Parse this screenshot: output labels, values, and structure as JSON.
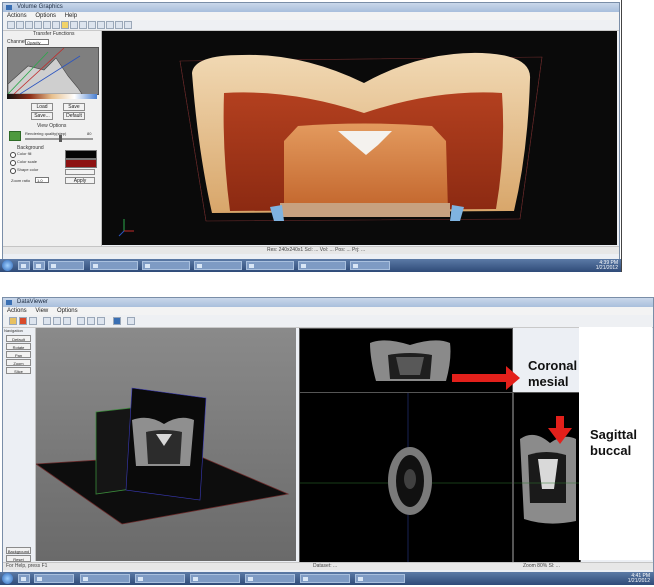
{
  "top_window": {
    "title": "Volume Graphics",
    "menu": [
      "Actions",
      "Options",
      "Help"
    ],
    "left_panel": {
      "section_title": "Transfer Functions",
      "channel_label": "Channel",
      "channel_value": "Opacity",
      "buttons": [
        "Load",
        "Save",
        "Save...",
        "Default"
      ],
      "view_section": "View Options",
      "quality_label": "Rendering quality(step)",
      "quality_value": "80",
      "background_label": "Background",
      "bg_options": [
        "Color fill",
        "Color scale",
        "Shape color"
      ],
      "zoom_label": "Zoom ratio",
      "zoom_value": "1.0",
      "apply_button": "Apply"
    },
    "status_text": "Res: 240x240x1 Scl: ... Vol: ... Pos: ... Prj: ...",
    "colors": {
      "bg_dark": "#0a0a0a",
      "tooth_outer": "#e9c79a",
      "tooth_inner": "#a8361c"
    }
  },
  "top_taskbar": {
    "tasks": [
      "",
      ""
    ],
    "tray_time": "4:39 PM",
    "tray_date": "1/21/2012"
  },
  "bottom_window": {
    "title": "DataViewer",
    "menu": [
      "Actions",
      "View",
      "Options"
    ],
    "left_buttons_title": "Navigation",
    "left_buttons": [
      "Default",
      "Rotate",
      "Pan",
      "Zoom",
      "Slice"
    ],
    "bottom_left_buttons": [
      "Background",
      "Reset"
    ],
    "status_left": "For Help, press F1",
    "status_mid": "Dataset: ...",
    "status_right": "Zoom 80% Sl: ..."
  },
  "bottom_taskbar": {
    "tray_time": "4:41 PM",
    "tray_date": "1/21/2012"
  },
  "annotations": {
    "coronal_line1": "Coronal",
    "coronal_line2": "mesial",
    "sagittal_line1": "Sagittal",
    "sagittal_line2": "buccal",
    "arrow_color": "#e3201b"
  }
}
